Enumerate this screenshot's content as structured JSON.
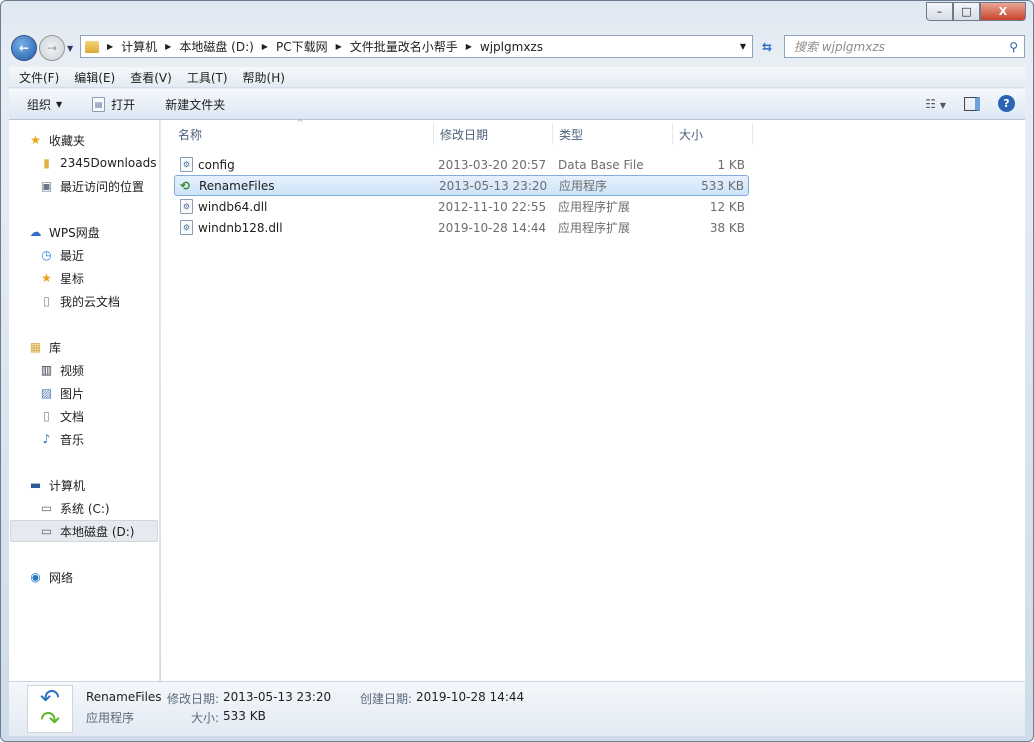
{
  "window": {
    "min": "–",
    "max": "□",
    "close": "X"
  },
  "address": {
    "segments": [
      "计算机",
      "本地磁盘 (D:)",
      "PC下载网",
      "文件批量改名小帮手",
      "wjplgmxzs"
    ]
  },
  "search": {
    "placeholder": "搜索 wjplgmxzs"
  },
  "menu": [
    "文件(F)",
    "编辑(E)",
    "查看(V)",
    "工具(T)",
    "帮助(H)"
  ],
  "toolbar": {
    "organize": "组织",
    "open": "打开",
    "new_folder": "新建文件夹",
    "help": "?"
  },
  "sidebar": [
    {
      "label": "收藏夹",
      "icon": "star"
    },
    {
      "label": "2345Downloads",
      "icon": "folder"
    },
    {
      "label": "最近访问的位置",
      "icon": "recent-places"
    },
    {
      "label": "WPS网盘",
      "icon": "cloud"
    },
    {
      "label": "最近",
      "icon": "clock"
    },
    {
      "label": "星标",
      "icon": "star"
    },
    {
      "label": "我的云文档",
      "icon": "document"
    },
    {
      "label": "库",
      "icon": "library"
    },
    {
      "label": "视频",
      "icon": "video"
    },
    {
      "label": "图片",
      "icon": "picture"
    },
    {
      "label": "文档",
      "icon": "document"
    },
    {
      "label": "音乐",
      "icon": "music"
    },
    {
      "label": "计算机",
      "icon": "computer"
    },
    {
      "label": "系统 (C:)",
      "icon": "drive"
    },
    {
      "label": "本地磁盘 (D:)",
      "icon": "drive"
    },
    {
      "label": "网络",
      "icon": "network"
    }
  ],
  "columns": [
    "名称",
    "修改日期",
    "类型",
    "大小"
  ],
  "files": [
    {
      "name": "config",
      "date": "2013-03-20 20:57",
      "type": "Data Base File",
      "size": "1 KB"
    },
    {
      "name": "RenameFiles",
      "date": "2013-05-13 23:20",
      "type": "应用程序",
      "size": "533 KB"
    },
    {
      "name": "windb64.dll",
      "date": "2012-11-10 22:55",
      "type": "应用程序扩展",
      "size": "12 KB"
    },
    {
      "name": "windnb128.dll",
      "date": "2019-10-28 14:44",
      "type": "应用程序扩展",
      "size": "38 KB"
    }
  ],
  "status": {
    "name": "RenameFiles",
    "modified_label": "修改日期:",
    "modified": "2013-05-13 23:20",
    "created_label": "创建日期:",
    "created": "2019-10-28 14:44",
    "type": "应用程序",
    "size_label": "大小:",
    "size": "533 KB"
  }
}
